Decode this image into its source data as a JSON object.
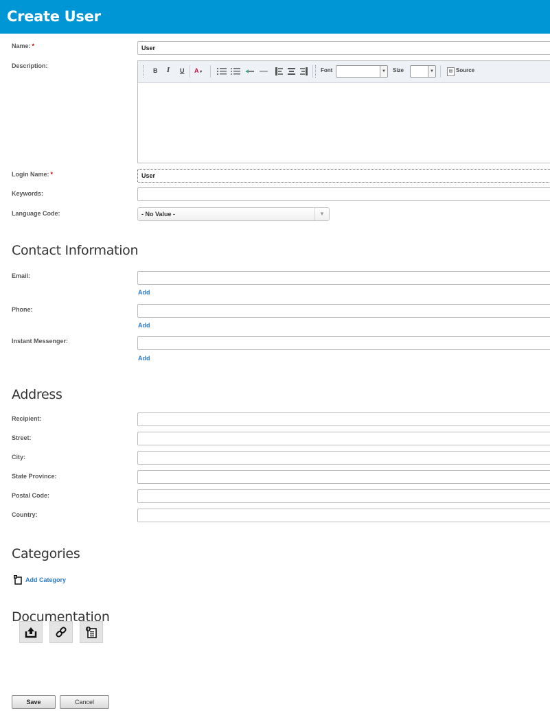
{
  "header": {
    "title": "Create User"
  },
  "form": {
    "name": {
      "label": "Name:",
      "value": "User",
      "required_mark": "*"
    },
    "description": {
      "label": "Description:"
    },
    "login": {
      "label": "Login Name:",
      "value": "User",
      "required_mark": "*"
    },
    "keywords": {
      "label": "Keywords:",
      "value": ""
    },
    "language": {
      "label": "Language Code:",
      "value": "- No Value -"
    }
  },
  "editor": {
    "toolbar": {
      "bold": "B",
      "italic": "I",
      "underline": "U",
      "font_color": "A",
      "font_label": "Font",
      "size_label": "Size",
      "source_label": "Source"
    }
  },
  "contact": {
    "title": "Contact Information",
    "email_label": "Email:",
    "phone_label": "Phone:",
    "im_label": "Instant Messenger:",
    "add_label": "Add"
  },
  "address": {
    "title": "Address",
    "fields": [
      "Recipient:",
      "Street:",
      "City:",
      "State Province:",
      "Postal Code:",
      "Country:"
    ]
  },
  "categories": {
    "title": "Categories",
    "add_label": "Add Category"
  },
  "documentation": {
    "title": "Documentation"
  },
  "actions": {
    "save": "Save",
    "cancel": "Cancel"
  },
  "colors": {
    "header_bg": "#0095d5",
    "link": "#2a7ac4",
    "required": "#cc0000"
  }
}
